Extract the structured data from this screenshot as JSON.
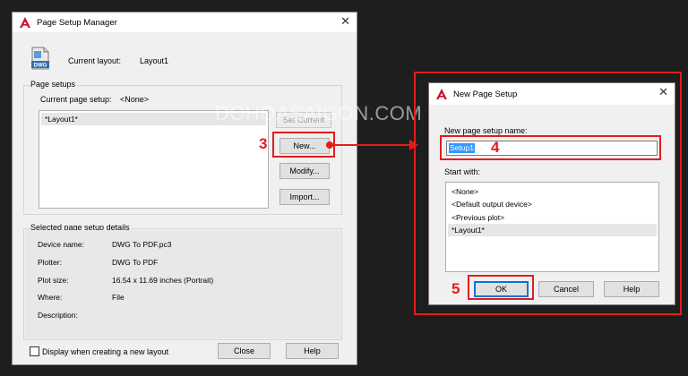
{
  "psm": {
    "title": "Page Setup Manager",
    "current_layout_label": "Current layout:",
    "current_layout_value": "Layout1",
    "icon_label": "DWG",
    "page_setups_group": "Page setups",
    "current_page_setup_label": "Current page setup:",
    "current_page_setup_value": "<None>",
    "list_items": [
      "*Layout1*"
    ],
    "set_current_label": "Set Current",
    "new_label": "New...",
    "modify_label": "Modify...",
    "import_label": "Import...",
    "details_group": "Selected page setup details",
    "details": [
      {
        "label": "Device name:",
        "value": "DWG To PDF.pc3"
      },
      {
        "label": "Plotter:",
        "value": "DWG To PDF"
      },
      {
        "label": "Plot size:",
        "value": "16.54 x 11.69 inches (Portrait)"
      },
      {
        "label": "Where:",
        "value": "File"
      },
      {
        "label": "Description:",
        "value": ""
      }
    ],
    "checkbox_label": "Display when creating a new layout",
    "close_label": "Close",
    "help_label": "Help"
  },
  "nps": {
    "title": "New Page Setup",
    "name_label": "New page setup name:",
    "name_value": "Setup1",
    "start_with_label": "Start with:",
    "list_items": [
      "<None>",
      "<Default output device>",
      "<Previous plot>",
      "*Layout1*"
    ],
    "ok_label": "OK",
    "cancel_label": "Cancel",
    "help_label": "Help"
  },
  "annotations": {
    "step3": "3",
    "step4": "4",
    "step5": "5",
    "color": "#e41c1c"
  },
  "watermark": "DOHOASAIGON.COM",
  "colors": {
    "dialog_bg": "#f0f0f0",
    "background": "#1e1e1e",
    "autocad_red": "#c8102e",
    "selection_blue": "#3399ff"
  }
}
